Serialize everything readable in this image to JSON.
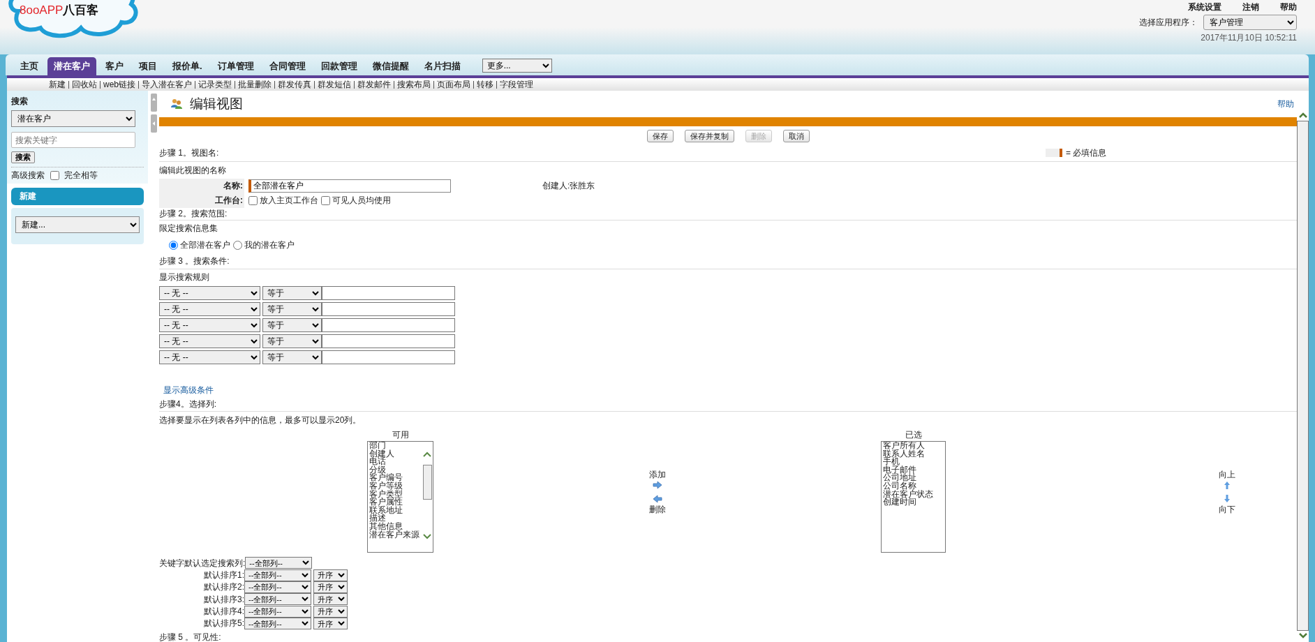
{
  "logo": {
    "latin": "8ooAPP",
    "chinese": "八百客"
  },
  "top_links": [
    "系统设置",
    "注销",
    "帮助"
  ],
  "app_selector": {
    "label": "选择应用程序：",
    "value": "客户管理"
  },
  "datetime": "2017年11月10日 10:52:11",
  "tabs": [
    {
      "label": "主页",
      "selected": false
    },
    {
      "label": "潜在客户",
      "selected": true
    },
    {
      "label": "客户",
      "selected": false
    },
    {
      "label": "项目",
      "selected": false
    },
    {
      "label": "报价单.",
      "selected": false
    },
    {
      "label": "订单管理",
      "selected": false
    },
    {
      "label": "合同管理",
      "selected": false
    },
    {
      "label": "回款管理",
      "selected": false
    },
    {
      "label": "微信提醒",
      "selected": false
    },
    {
      "label": "名片扫描",
      "selected": false
    }
  ],
  "more_select": {
    "value": "更多..."
  },
  "subnav": [
    "新建",
    "回收站",
    "web链接",
    "导入潜在客户",
    "记录类型",
    "批量删除",
    "群发传真",
    "群发短信",
    "群发邮件",
    "搜索布局",
    "页面布局",
    "转移",
    "字段管理"
  ],
  "sidebar": {
    "search": {
      "title": "搜索",
      "scope": "潜在客户",
      "placeholder": "搜索关键字",
      "button": "搜索",
      "advanced_link": "高级搜索",
      "exact_match": {
        "label": "完全相等",
        "checked": false
      }
    },
    "create": {
      "title": "新建",
      "select_value": "新建..."
    }
  },
  "page": {
    "title": "编辑视图",
    "help": "帮助",
    "buttons": [
      {
        "label": "保存",
        "disabled": false
      },
      {
        "label": "保存并复制",
        "disabled": false
      },
      {
        "label": "删除",
        "disabled": true
      },
      {
        "label": "取消",
        "disabled": false
      }
    ],
    "required_legend": "= 必填信息"
  },
  "step1": {
    "heading": "步骤 1。视图名:",
    "subheading": "编辑此视图的名称",
    "name_label": "名称:",
    "name_value": "全部潜在客户",
    "creator": "创建人:张胜东",
    "workbench_label": "工作台:",
    "workbench_options": [
      {
        "label": "放入主页工作台",
        "checked": false
      },
      {
        "label": "可见人员均使用",
        "checked": false
      }
    ]
  },
  "step2": {
    "heading": "步骤 2。搜索范围:",
    "subheading": "限定搜索信息集",
    "options": [
      {
        "label": "全部潜在客户",
        "selected": true
      },
      {
        "label": "我的潜在客户",
        "selected": false
      }
    ]
  },
  "step3": {
    "heading": "步骤 3 。搜索条件:",
    "subheading": "显示搜索规则",
    "filters": [
      {
        "field": "-- 无 --",
        "operator": "等于"
      },
      {
        "field": "-- 无 --",
        "operator": "等于"
      },
      {
        "field": "-- 无 --",
        "operator": "等于"
      },
      {
        "field": "-- 无 --",
        "operator": "等于"
      },
      {
        "field": "-- 无 --",
        "operator": "等于"
      }
    ],
    "advanced_link": "显示高级条件"
  },
  "step4": {
    "heading": "步骤4。选择列:",
    "hint": "选择要显示在列表各列中的信息，最多可以显示20列。",
    "available": {
      "title": "可用",
      "items": [
        "部门",
        "创建人",
        "电话",
        "分级",
        "客户编号",
        "客户等级",
        "客户类型",
        "客户属性",
        "联系地址",
        "描述",
        "其他信息",
        "潜在客户来源"
      ]
    },
    "add": "添加",
    "remove": "删除",
    "selected": {
      "title": "已选",
      "items": [
        "客户所有人",
        "联系人姓名",
        "手机",
        "电子邮件",
        "公司地址",
        "公司名称",
        "潜在客户状态",
        "创建时间"
      ]
    },
    "up": "向上",
    "down": "向下",
    "keyword_label": "关键字默认选定搜索列:",
    "keyword_value": "--全部列--",
    "sorts": [
      {
        "label": "默认排序1:",
        "column": "--全部列--",
        "order": "升序"
      },
      {
        "label": "默认排序2:",
        "column": "--全部列--",
        "order": "升序"
      },
      {
        "label": "默认排序3:",
        "column": "--全部列--",
        "order": "升序"
      },
      {
        "label": "默认排序4:",
        "column": "--全部列--",
        "order": "升序"
      },
      {
        "label": "默认排序5:",
        "column": "--全部列--",
        "order": "升序"
      }
    ]
  },
  "step5": {
    "heading": "步骤 5 。可见性:"
  }
}
